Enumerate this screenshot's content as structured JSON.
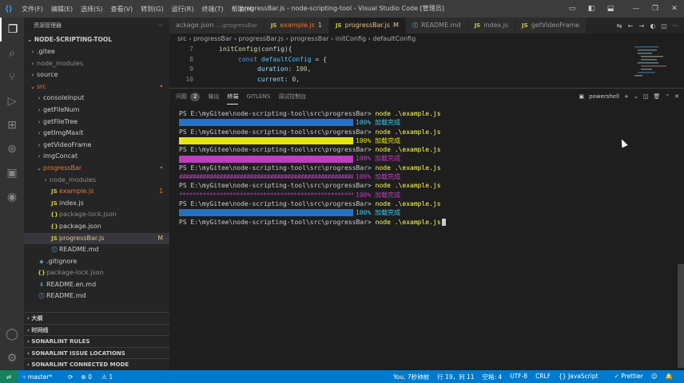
{
  "titlebar": {
    "menu": [
      "文件(F)",
      "编辑(E)",
      "选择(S)",
      "查看(V)",
      "转到(G)",
      "运行(R)",
      "终端(T)",
      "帮助(H)"
    ],
    "title": "progressBar.js - node-scripting-tool - Visual Studio Code [管理员]"
  },
  "sidebar": {
    "header": "资源管理器",
    "project": "NODE-SCRIPTING-TOOL",
    "tree": [
      {
        "label": ".gitee",
        "indent": 1,
        "chev": "›",
        "icon": "",
        "cls": ""
      },
      {
        "label": "node_modules",
        "indent": 1,
        "chev": "›",
        "icon": "",
        "cls": "c-dim"
      },
      {
        "label": "source",
        "indent": 1,
        "chev": "›",
        "icon": "",
        "cls": ""
      },
      {
        "label": "src",
        "indent": 1,
        "chev": "⌄",
        "icon": "",
        "cls": "c-red",
        "dot": "•"
      },
      {
        "label": "consoleInput",
        "indent": 2,
        "chev": "›",
        "icon": "",
        "cls": ""
      },
      {
        "label": "getFileNum",
        "indent": 2,
        "chev": "›",
        "icon": "",
        "cls": ""
      },
      {
        "label": "getFileTree",
        "indent": 2,
        "chev": "›",
        "icon": "",
        "cls": ""
      },
      {
        "label": "getImgMaxit",
        "indent": 2,
        "chev": "›",
        "icon": "",
        "cls": ""
      },
      {
        "label": "getVideoFrame",
        "indent": 2,
        "chev": "›",
        "icon": "",
        "cls": ""
      },
      {
        "label": "imgConcat",
        "indent": 2,
        "chev": "›",
        "icon": "",
        "cls": ""
      },
      {
        "label": "progressBar",
        "indent": 2,
        "chev": "⌄",
        "icon": "",
        "cls": "c-red",
        "dot": "•"
      },
      {
        "label": "node_modules",
        "indent": 3,
        "chev": "›",
        "icon": "",
        "cls": "c-dim"
      },
      {
        "label": "example.js",
        "indent": 3,
        "chev": "",
        "icon": "JS",
        "cls": "c-red",
        "badge": "1"
      },
      {
        "label": "index.js",
        "indent": 3,
        "chev": "",
        "icon": "JS",
        "cls": ""
      },
      {
        "label": "package-lock.json",
        "indent": 3,
        "chev": "",
        "icon": "{}",
        "cls": "c-dim"
      },
      {
        "label": "package.json",
        "indent": 3,
        "chev": "",
        "icon": "{}",
        "cls": ""
      },
      {
        "label": "progressBar.js",
        "indent": 3,
        "chev": "",
        "icon": "JS",
        "cls": "c-orange",
        "badge": "M",
        "selected": true
      },
      {
        "label": "README.md",
        "indent": 3,
        "chev": "",
        "icon": "ⓘ",
        "cls": ""
      },
      {
        "label": ".gitignore",
        "indent": 1,
        "chev": "",
        "icon": "◆",
        "cls": ""
      },
      {
        "label": "package-lock.json",
        "indent": 1,
        "chev": "",
        "icon": "{}",
        "cls": "c-dim"
      },
      {
        "label": "README.en.md",
        "indent": 1,
        "chev": "",
        "icon": "⬇",
        "cls": ""
      },
      {
        "label": "README.md",
        "indent": 1,
        "chev": "",
        "icon": "ⓘ",
        "cls": ""
      }
    ],
    "sections": [
      "大纲",
      "时间线",
      "SONARLINT RULES",
      "SONARLINT ISSUE LOCATIONS",
      "SONARLINT CONNECTED MODE"
    ]
  },
  "tabs": [
    {
      "label": "ackage.json",
      "sub": "...\\progressBar",
      "icon": "",
      "active": false
    },
    {
      "label": "example.js",
      "sub": "",
      "icon": "JS",
      "badge": "1",
      "active": false,
      "cls": "c-red"
    },
    {
      "label": "progressBar.js",
      "sub": "",
      "icon": "JS",
      "badge": "M",
      "active": true,
      "cls": "c-orange"
    },
    {
      "label": "README.md",
      "sub": "",
      "icon": "ⓘ",
      "active": false
    },
    {
      "label": "index.js",
      "sub": "",
      "icon": "JS",
      "active": false
    },
    {
      "label": "getVideoFrame",
      "sub": "",
      "icon": "JS",
      "active": false
    }
  ],
  "breadcrumb": {
    "parts": [
      "src",
      "progressBar",
      "progressBar.js",
      "progressBar",
      "initConfig",
      "defaultConfig"
    ]
  },
  "editor": {
    "lines": [
      {
        "n": "7",
        "tokens": [
          [
            "fn",
            "initConfig"
          ],
          [
            "pl",
            "(config){"
          ]
        ],
        "indent": 0
      },
      {
        "n": "8",
        "tokens": [
          [
            "kw",
            "const "
          ],
          [
            "cst",
            "defaultConfig"
          ],
          [
            "pl",
            " = {"
          ]
        ],
        "indent": 1
      },
      {
        "n": "9",
        "tokens": [
          [
            "var",
            "duration"
          ],
          [
            "pl",
            ": "
          ],
          [
            "num",
            "100"
          ],
          [
            "pl",
            ","
          ]
        ],
        "indent": 2
      },
      {
        "n": "10",
        "tokens": [
          [
            "var",
            "current"
          ],
          [
            "pl",
            ": "
          ],
          [
            "num",
            "0"
          ],
          [
            "pl",
            ","
          ]
        ],
        "indent": 2
      }
    ]
  },
  "panel": {
    "tabs": [
      {
        "label": "问题",
        "badge": "2"
      },
      {
        "label": "输出"
      },
      {
        "label": "终端",
        "active": true
      },
      {
        "label": "GITLENS"
      },
      {
        "label": "调试控制台"
      }
    ],
    "shell": "powershell",
    "prompt": "PS E:\\myGitee\\node-scripting-tool\\src\\progressBar>",
    "command": "node .\\example.js",
    "done_text": "100% 加载完成",
    "hash_bar": "######################################################",
    "star_bar": "******************************************************",
    "runs": [
      {
        "bar": "blue",
        "done_color": "#3fc9f0"
      },
      {
        "bar": "yellow",
        "done_color": "#e5e510"
      },
      {
        "bar": "magenta",
        "done_color": "#bc3fbc"
      },
      {
        "bar": "hash",
        "done_color": "#bc3fbc"
      },
      {
        "bar": "star",
        "done_color": "#bc3fbc"
      },
      {
        "bar": "blue",
        "done_color": "#3fc9f0"
      }
    ]
  },
  "statusbar": {
    "branch": "master*",
    "sync": "⟳",
    "errors": "0",
    "warnings": "1",
    "author": "You, 7秒钟前",
    "position": "行 19，列 11",
    "spaces": "空格: 4",
    "encoding": "UTF-8",
    "eol": "CRLF",
    "language": "JavaScript",
    "prettier": "✓ Prettier"
  },
  "colors": {
    "accent": "#007acc",
    "bar_blue": "#2472c8",
    "bar_yellow": "#e5e510",
    "bar_magenta": "#bc3fbc"
  }
}
